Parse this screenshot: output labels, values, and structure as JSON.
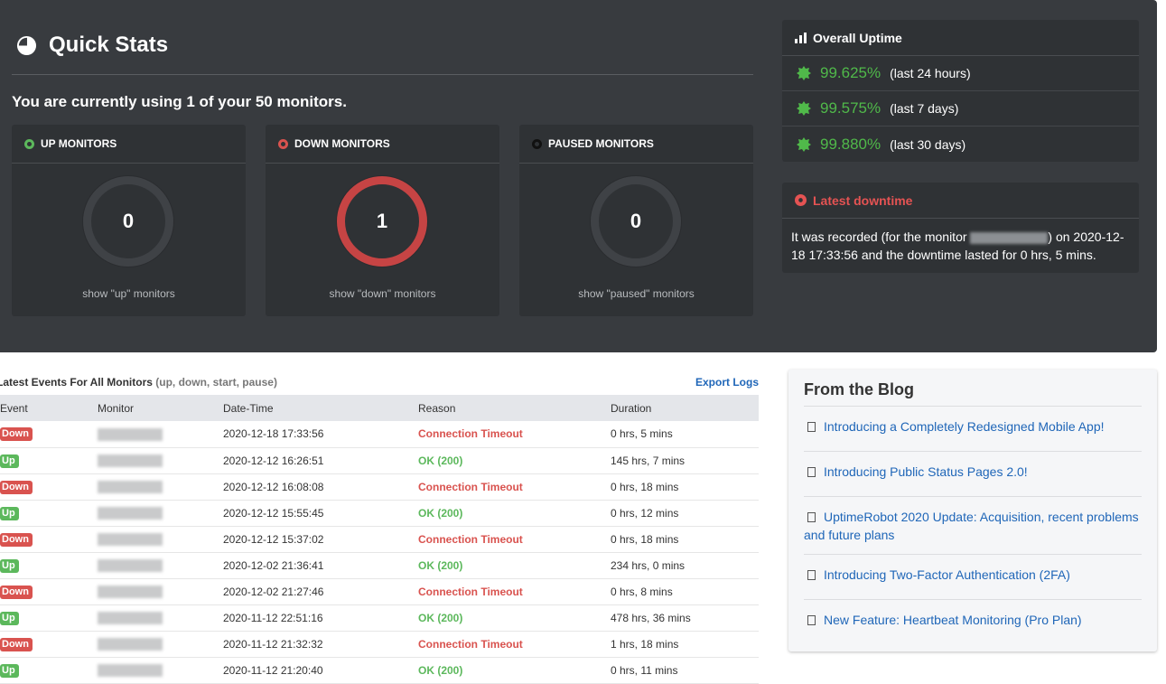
{
  "quick_stats": {
    "title": "Quick Stats",
    "subtitle": "You are currently using 1 of your 50 monitors.",
    "cards": [
      {
        "label": "UP MONITORS",
        "count": "0",
        "link": "show \"up\" monitors",
        "color": "#5cb85c"
      },
      {
        "label": "DOWN MONITORS",
        "count": "1",
        "link": "show \"down\" monitors",
        "color": "#d9534f"
      },
      {
        "label": "PAUSED MONITORS",
        "count": "0",
        "link": "show \"paused\" monitors",
        "color": "#111111"
      }
    ]
  },
  "uptime": {
    "title": "Overall Uptime",
    "rows": [
      {
        "pct": "99.625%",
        "period": "(last 24 hours)"
      },
      {
        "pct": "99.575%",
        "period": "(last 7 days)"
      },
      {
        "pct": "99.880%",
        "period": "(last 30 days)"
      }
    ]
  },
  "downtime": {
    "title": "Latest downtime",
    "text_before": "It was recorded (for the monitor ",
    "text_after": ") on 2020-12-18 17:33:56 and the downtime lasted for 0 hrs, 5 mins."
  },
  "events": {
    "title": "Latest Events For All Monitors",
    "subtitle": "(up, down, start, pause)",
    "export_label": "Export Logs",
    "columns": [
      "Event",
      "Monitor",
      "Date-Time",
      "Reason",
      "Duration"
    ],
    "rows": [
      {
        "event": "Down",
        "datetime": "2020-12-18 17:33:56",
        "reason": "Connection Timeout",
        "duration": "0 hrs, 5 mins"
      },
      {
        "event": "Up",
        "datetime": "2020-12-12 16:26:51",
        "reason": "OK (200)",
        "duration": "145 hrs, 7 mins"
      },
      {
        "event": "Down",
        "datetime": "2020-12-12 16:08:08",
        "reason": "Connection Timeout",
        "duration": "0 hrs, 18 mins"
      },
      {
        "event": "Up",
        "datetime": "2020-12-12 15:55:45",
        "reason": "OK (200)",
        "duration": "0 hrs, 12 mins"
      },
      {
        "event": "Down",
        "datetime": "2020-12-12 15:37:02",
        "reason": "Connection Timeout",
        "duration": "0 hrs, 18 mins"
      },
      {
        "event": "Up",
        "datetime": "2020-12-02 21:36:41",
        "reason": "OK (200)",
        "duration": "234 hrs, 0 mins"
      },
      {
        "event": "Down",
        "datetime": "2020-12-02 21:27:46",
        "reason": "Connection Timeout",
        "duration": "0 hrs, 8 mins"
      },
      {
        "event": "Up",
        "datetime": "2020-11-12 22:51:16",
        "reason": "OK (200)",
        "duration": "478 hrs, 36 mins"
      },
      {
        "event": "Down",
        "datetime": "2020-11-12 21:32:32",
        "reason": "Connection Timeout",
        "duration": "1 hrs, 18 mins"
      },
      {
        "event": "Up",
        "datetime": "2020-11-12 21:20:40",
        "reason": "OK (200)",
        "duration": "0 hrs, 11 mins"
      }
    ]
  },
  "blog": {
    "title": "From the Blog",
    "items": [
      "Introducing a Completely Redesigned Mobile App!",
      "Introducing Public Status Pages 2.0!",
      "UptimeRobot 2020 Update: Acquisition, recent problems and future plans",
      "Introducing Two-Factor Authentication (2FA)",
      "New Feature: Heartbeat Monitoring (Pro Plan)"
    ]
  },
  "icons": {
    "quick_stats": "pie-chart-icon",
    "uptime": "bar-chart-icon",
    "uptime_rows": "certificate-icon",
    "downtime": "times-circle-icon",
    "blog_items": "document-icon"
  }
}
